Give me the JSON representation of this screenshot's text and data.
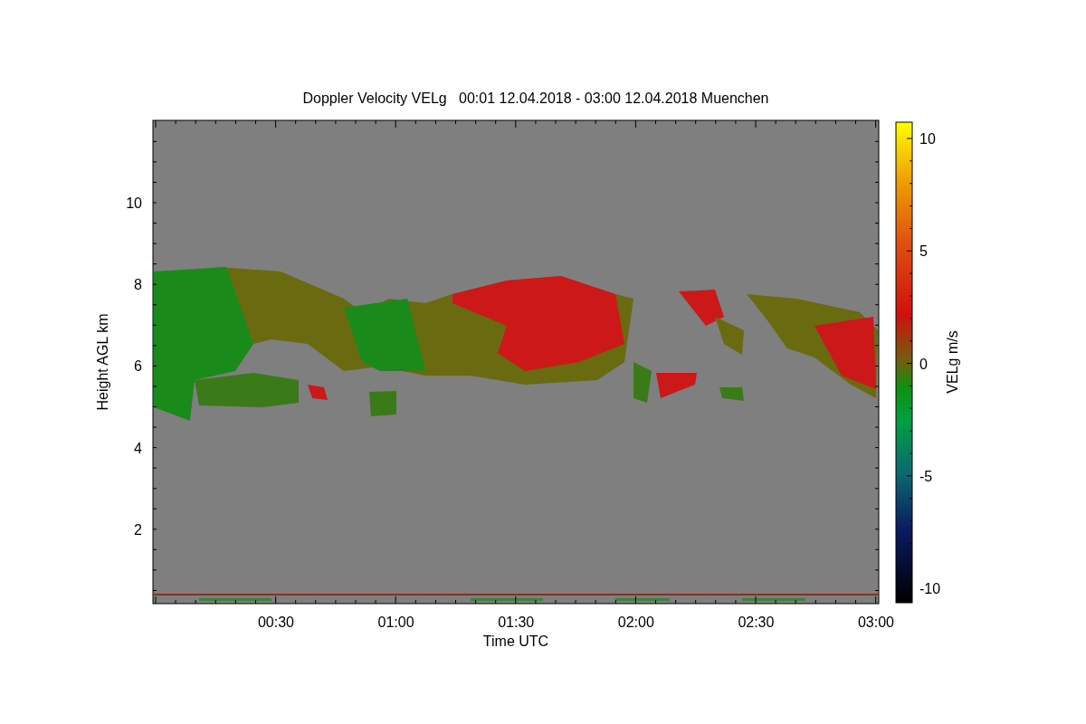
{
  "title": "Doppler Velocity VELg   00:01 12.04.2018 - 03:00 12.04.2018 Muenchen",
  "x_axis": {
    "label": "Time UTC",
    "ticks": [
      "00:30",
      "01:00",
      "01:30",
      "02:00",
      "02:30",
      "03:00"
    ]
  },
  "y_axis": {
    "label": "Height AGL km",
    "ticks": [
      "10",
      "8",
      "6",
      "4",
      "2"
    ]
  },
  "colorbar": {
    "label": "VELg m/s",
    "ticks": [
      "10",
      "5",
      "0",
      "-5",
      "-10"
    ]
  }
}
